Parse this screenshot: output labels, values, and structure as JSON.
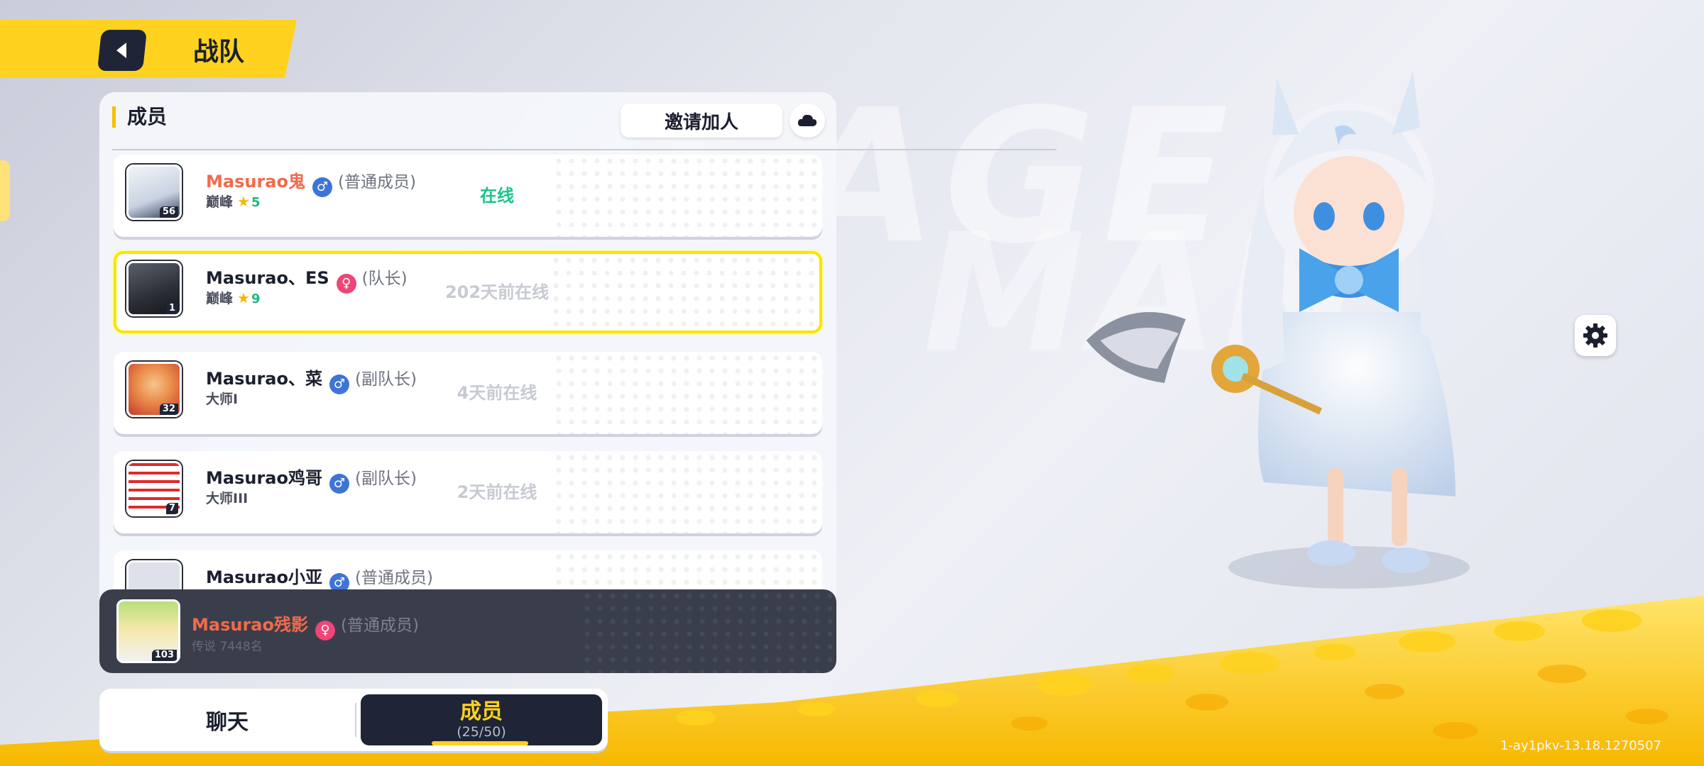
{
  "header": {
    "title": "战队",
    "back_icon": "back-arrow-icon"
  },
  "panel": {
    "tab_label": "成员",
    "invite_label": "邀请加人",
    "cloud_icon": "cloud-icon"
  },
  "members": [
    {
      "name": "Masurao鬼",
      "gender": "male",
      "gender_symbol": "♂",
      "role": "(普通成员)",
      "rank": "巅峰",
      "rank_stars": "5",
      "status": "在线",
      "online": true,
      "level": "56",
      "name_color": "#f26a4b"
    },
    {
      "name": "Masurao、ES",
      "gender": "female",
      "gender_symbol": "♀",
      "role": "(队长)",
      "rank": "巅峰",
      "rank_stars": "9",
      "status": "202天前在线",
      "online": false,
      "level": "1",
      "selected": true
    },
    {
      "name": "Masurao、菜",
      "gender": "male",
      "gender_symbol": "♂",
      "role": "(副队长)",
      "rank": "大师I",
      "status": "4天前在线",
      "online": false,
      "level": "32"
    },
    {
      "name": "Masurao鸡哥",
      "gender": "male",
      "gender_symbol": "♂",
      "role": "(副队长)",
      "rank": "大师III",
      "status": "2天前在线",
      "online": false,
      "level": "7"
    },
    {
      "name": "Masurao小亚",
      "gender": "male",
      "gender_symbol": "♂",
      "role": "(普通成员)",
      "rank": "",
      "status": "",
      "online": false,
      "level": ""
    }
  ],
  "self": {
    "name": "Masurao残影",
    "gender": "female",
    "gender_symbol": "♀",
    "role": "(普通成员)",
    "rank": "传说 7448名",
    "level": "103"
  },
  "bottom_tabs": {
    "chat": "聊天",
    "members": "成员",
    "members_count": "(25/50)"
  },
  "settings_icon": "gear-icon",
  "version": "1-ay1pkv-13.18.1270507",
  "background_text": "USAGE MAN",
  "colors": {
    "accent_yellow": "#ffd21f",
    "dark_navy": "#1f2436",
    "online_green": "#1ec489",
    "name_red": "#f26a4b"
  }
}
